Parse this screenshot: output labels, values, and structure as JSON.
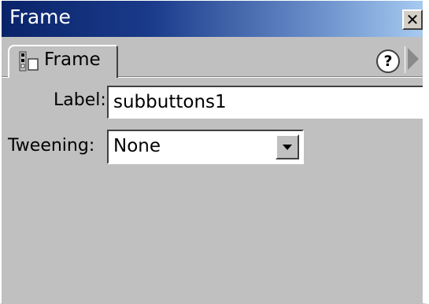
{
  "window": {
    "title": "Frame",
    "close_glyph": "✕"
  },
  "tabs": [
    {
      "label": "Frame",
      "icon": "frame-properties-icon",
      "active": true
    }
  ],
  "toolbar": {
    "help_glyph": "?",
    "help_icon": "help-icon",
    "expand_icon": "expand-arrow-icon"
  },
  "form": {
    "label_field": {
      "label": "Label:",
      "value": "subbuttons1"
    },
    "tweening_field": {
      "label": "Tweening:",
      "value": "None"
    }
  },
  "colors": {
    "title_gradient_start": "#0a246a",
    "title_gradient_end": "#a6caf0",
    "panel_background": "#c0c0c0"
  }
}
